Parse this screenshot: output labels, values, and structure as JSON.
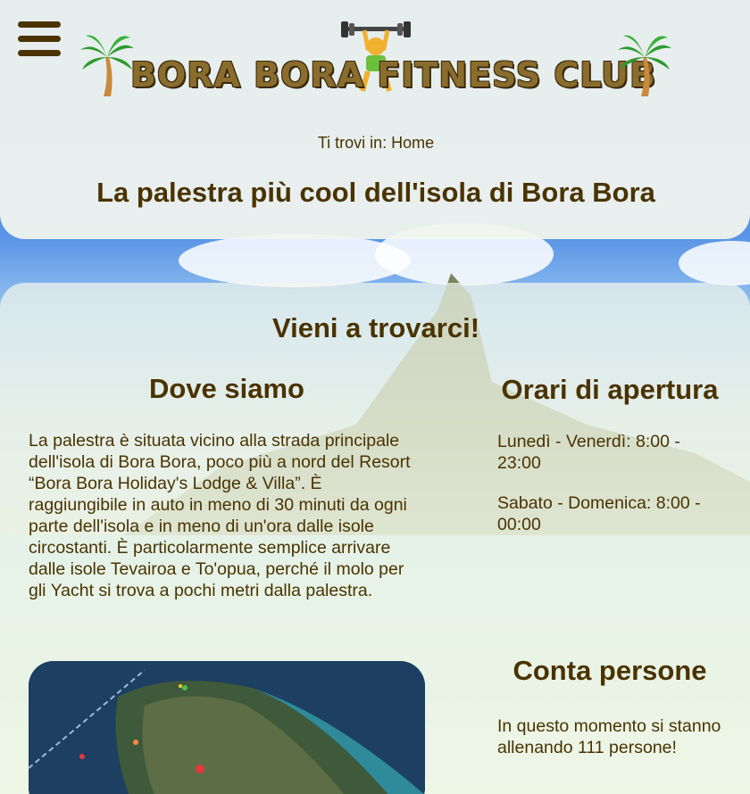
{
  "header": {
    "logo_text": "BORA BORA FITNESS CLUB",
    "breadcrumb": "Ti trovi in: Home",
    "title": "La palestra più cool dell'isola di Bora Bora"
  },
  "main": {
    "section_title": "Vieni a trovarci!",
    "location": {
      "heading": "Dove siamo",
      "text": "La palestra è situata vicino alla strada principale dell'isola di Bora Bora, poco più a nord del Resort “Bora Bora Holiday's Lodge & Villa”. È raggiungibile in auto in meno di 30 minuti da ogni parte dell'isola e in meno di un'ora dalle isole circostanti. È particolarmente semplice arrivare dalle isole Tevairoa e To'opua, perché il molo per gli Yacht si trova a pochi metri dalla palestra."
    },
    "hours": {
      "heading": "Orari di apertura",
      "weekdays": "Lunedì - Venerdì: 8:00 - 23:00",
      "weekend": "Sabato - Domenica: 8:00 - 00:00"
    },
    "counter": {
      "heading": "Conta persone",
      "text": "In questo momento si stanno allenando 111 persone!"
    }
  },
  "colors": {
    "text": "#4a3300",
    "card": "#f0f4ee"
  }
}
